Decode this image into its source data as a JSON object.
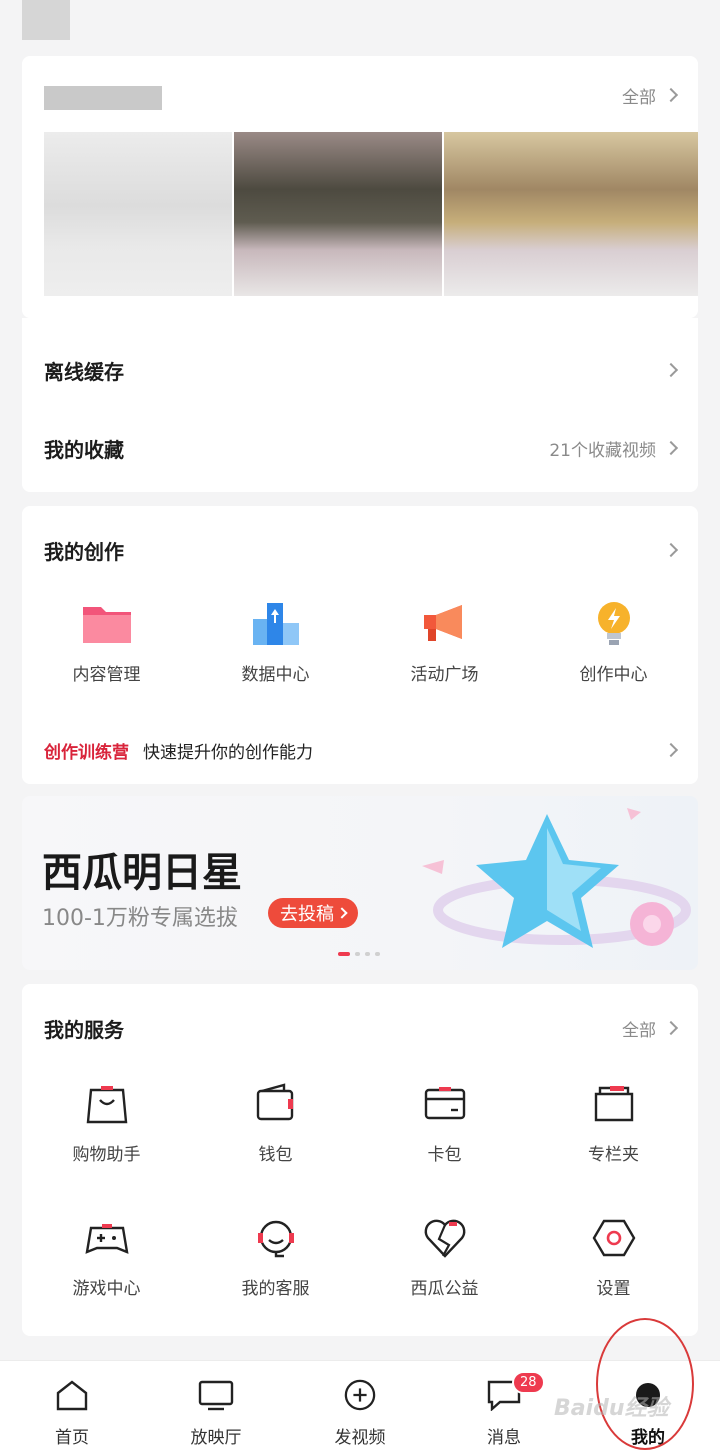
{
  "history": {
    "all_label": "全部"
  },
  "offline": {
    "label": "离线缓存"
  },
  "favorites": {
    "label": "我的收藏",
    "count_text": "21个收藏视频"
  },
  "creation": {
    "title": "我的创作",
    "items": [
      {
        "label": "内容管理",
        "icon": "folder-icon"
      },
      {
        "label": "数据中心",
        "icon": "data-center-icon"
      },
      {
        "label": "活动广场",
        "icon": "megaphone-icon"
      },
      {
        "label": "创作中心",
        "icon": "bulb-icon"
      }
    ],
    "camp_tag": "创作训练营",
    "camp_text": "快速提升你的创作能力"
  },
  "banner": {
    "title": "西瓜明日星",
    "subtitle": "100-1万粉专属选拔",
    "cta": "去投稿",
    "colors": {
      "cta": "#ee4b3b",
      "dot_active": "#ee3a4f"
    }
  },
  "services": {
    "title": "我的服务",
    "all_label": "全部",
    "items": [
      {
        "label": "购物助手",
        "icon": "shopping-bag-icon"
      },
      {
        "label": "钱包",
        "icon": "wallet-icon"
      },
      {
        "label": "卡包",
        "icon": "card-icon"
      },
      {
        "label": "专栏夹",
        "icon": "column-folder-icon"
      },
      {
        "label": "游戏中心",
        "icon": "gamepad-icon"
      },
      {
        "label": "我的客服",
        "icon": "headset-icon"
      },
      {
        "label": "西瓜公益",
        "icon": "heart-icon"
      },
      {
        "label": "设置",
        "icon": "settings-hex-icon"
      }
    ]
  },
  "tabbar": {
    "tabs": [
      {
        "label": "首页",
        "icon": "home-icon"
      },
      {
        "label": "放映厅",
        "icon": "tv-icon"
      },
      {
        "label": "发视频",
        "icon": "plus-circle-icon"
      },
      {
        "label": "消息",
        "icon": "message-icon",
        "badge": "28"
      },
      {
        "label": "我的",
        "icon": "profile-icon"
      }
    ]
  },
  "watermark": "Baidu经验",
  "colors": {
    "accent": "#ee3a4f",
    "background": "#f4f4f5"
  }
}
